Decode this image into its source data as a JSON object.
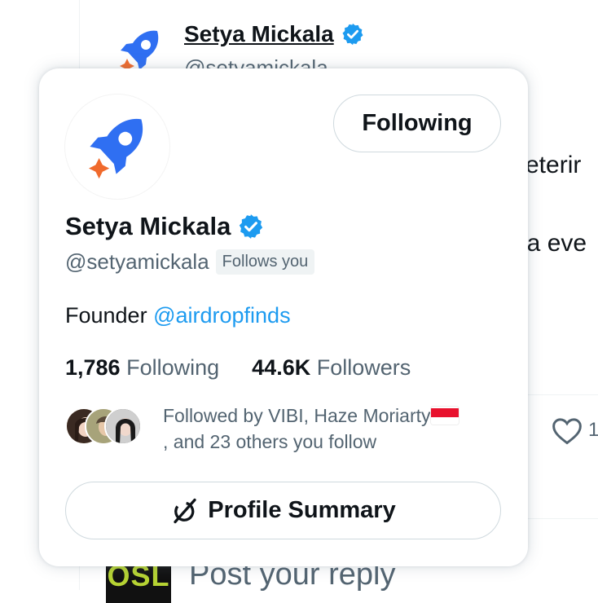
{
  "colors": {
    "verified": "#1d9bf0",
    "link": "#1d9bf0",
    "rocket": "#2f6ff2",
    "spark": "#f06a2c"
  },
  "background_tweet": {
    "name": "Setya Mickala",
    "handle": "@setyamickala",
    "text_line1": "keterir",
    "text_line2": "da eve",
    "like_count": "1",
    "reply_placeholder": "Post your reply",
    "reply_avatar_text": "OSL"
  },
  "card": {
    "follow_button": "Following",
    "name": "Setya Mickala",
    "handle": "@setyamickala",
    "follows_you": "Follows you",
    "bio_text": "Founder ",
    "bio_link": "@airdropfinds",
    "following_count": "1,786",
    "following_label": "Following",
    "followers_count": "44.6K",
    "followers_label": "Followers",
    "followed_by_line1": "Followed by VIBI, Haze Moriarty",
    "followed_by_line2": ", and 23 others you follow",
    "summary_button": "Profile Summary",
    "icons": [
      "rocket-logo-icon",
      "verified-badge-icon",
      "grok-icon",
      "indonesia-flag-icon",
      "heart-icon"
    ]
  }
}
